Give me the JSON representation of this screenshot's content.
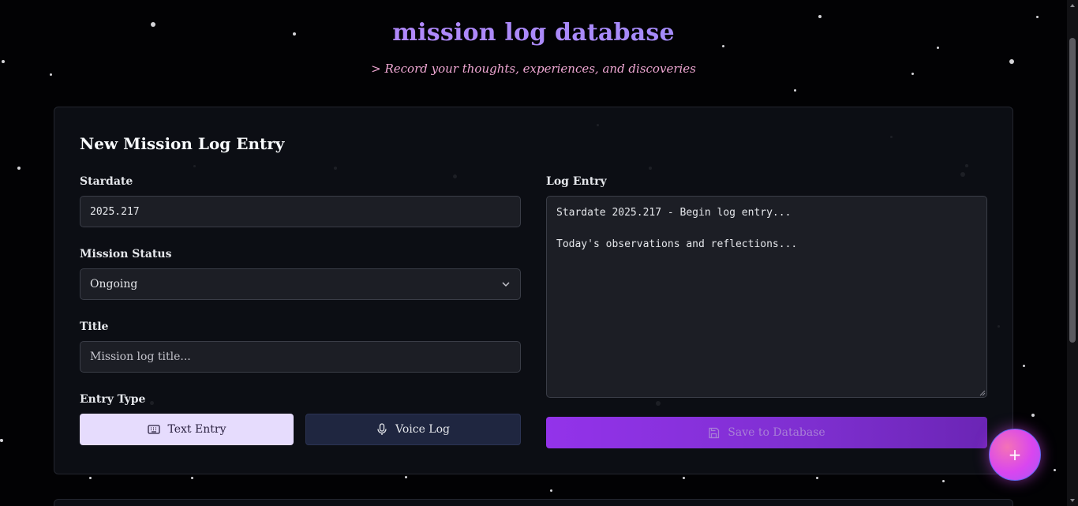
{
  "header": {
    "title": "mission log database",
    "subtitle": "> Record your thoughts, experiences, and discoveries"
  },
  "form": {
    "heading": "New Mission Log Entry",
    "stardate": {
      "label": "Stardate",
      "value": "2025.217"
    },
    "status": {
      "label": "Mission Status",
      "selected": "Ongoing"
    },
    "title_field": {
      "label": "Title",
      "placeholder": "Mission log title..."
    },
    "entry_type": {
      "label": "Entry Type",
      "options": [
        {
          "label": "Text Entry",
          "icon": "keyboard-icon",
          "active": true
        },
        {
          "label": "Voice Log",
          "icon": "microphone-icon",
          "active": false
        }
      ]
    },
    "log_entry": {
      "label": "Log Entry",
      "value": "Stardate 2025.217 - Begin log entry...\n\nToday's observations and reflections..."
    },
    "save_button": {
      "label": "Save to Database",
      "icon": "save-icon"
    }
  },
  "fab": {
    "label": "+",
    "icon": "plus-icon"
  },
  "colors": {
    "background": "#020204",
    "accent": "#9333ea",
    "title_gradient_start": "#c084fc",
    "subtitle": "#f0a8d4",
    "fab": "#d946ef"
  }
}
